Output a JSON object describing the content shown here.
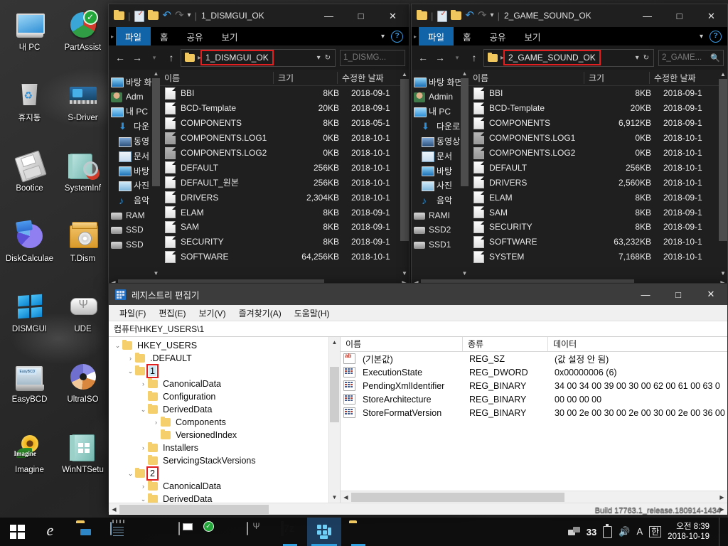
{
  "desktop": {
    "icons": [
      {
        "label": "내 PC",
        "icon": "my-computer-icon",
        "art": "ic-monitor"
      },
      {
        "label": "PartAssist",
        "icon": "partassist-icon",
        "art": "ic-pie"
      },
      {
        "label": "휴지통",
        "icon": "recycle-bin-icon",
        "art": "ic-bin"
      },
      {
        "label": "S-Driver",
        "icon": "s-driver-icon",
        "art": "ic-card"
      },
      {
        "label": "Bootice",
        "icon": "bootice-icon",
        "art": "ic-floppy"
      },
      {
        "label": "SystemInf",
        "icon": "systeminfo-icon",
        "art": "ic-book"
      },
      {
        "label": "DiskCalculae",
        "icon": "diskcalculator-icon",
        "art": "ic-pie2"
      },
      {
        "label": "T.Dism",
        "icon": "tdism-icon",
        "art": "ic-box"
      },
      {
        "label": "DISMGUI",
        "icon": "dismgui-icon",
        "art": "ic-win"
      },
      {
        "label": "UDE",
        "icon": "ude-usb-icon",
        "art": "ic-usb"
      },
      {
        "label": "EasyBCD",
        "icon": "easybcd-icon",
        "art": "ic-ebcd"
      },
      {
        "label": "UltraISO",
        "icon": "ultraiso-icon",
        "art": "ic-cd"
      },
      {
        "label": "Imagine",
        "icon": "imagine-icon",
        "art": "ic-flower",
        "badge": "Imagine"
      },
      {
        "label": "WinNTSetu",
        "icon": "winntsetup-icon",
        "art": "ic-ntbook"
      }
    ]
  },
  "explorer1": {
    "title": "1_DISMGUI_OK",
    "ribbon": {
      "file": "파일",
      "home": "홈",
      "share": "공유",
      "view": "보기",
      "help": "?"
    },
    "address": {
      "crumb": "1_DISMGUI_OK",
      "highlighted": true
    },
    "search": {
      "placeholder": "1_DISMG..."
    },
    "window_buttons": {
      "minimize": "—",
      "maximize": "□",
      "close": "✕"
    },
    "nav_pane": [
      {
        "label": "바탕 화",
        "icon": "desktop-icon"
      },
      {
        "label": "Adm",
        "icon": "user-icon"
      },
      {
        "label": "내 PC",
        "icon": "pc-icon"
      },
      {
        "label": "다운",
        "icon": "downloads-icon"
      },
      {
        "label": "동영",
        "icon": "videos-icon"
      },
      {
        "label": "문서",
        "icon": "documents-icon"
      },
      {
        "label": "바탕",
        "icon": "desktop-icon"
      },
      {
        "label": "사진",
        "icon": "pictures-icon"
      },
      {
        "label": "음악",
        "icon": "music-icon"
      },
      {
        "label": "RAM",
        "icon": "drive-icon"
      },
      {
        "label": "SSD",
        "icon": "drive-icon"
      },
      {
        "label": "SSD",
        "icon": "drive-icon"
      }
    ],
    "columns": {
      "name": "이름",
      "size": "크기",
      "date": "수정한 날짜"
    },
    "files": [
      {
        "name": "BBI",
        "size": "8KB",
        "date": "2018-09-1",
        "dim": false
      },
      {
        "name": "BCD-Template",
        "size": "20KB",
        "date": "2018-09-1",
        "dim": false
      },
      {
        "name": "COMPONENTS",
        "size": "8KB",
        "date": "2018-05-1",
        "dim": false
      },
      {
        "name": "COMPONENTS.LOG1",
        "size": "0KB",
        "date": "2018-10-1",
        "dim": true
      },
      {
        "name": "COMPONENTS.LOG2",
        "size": "0KB",
        "date": "2018-10-1",
        "dim": true
      },
      {
        "name": "DEFAULT",
        "size": "256KB",
        "date": "2018-10-1",
        "dim": false
      },
      {
        "name": "DEFAULT_원본",
        "size": "256KB",
        "date": "2018-10-1",
        "dim": false
      },
      {
        "name": "DRIVERS",
        "size": "2,304KB",
        "date": "2018-10-1",
        "dim": false
      },
      {
        "name": "ELAM",
        "size": "8KB",
        "date": "2018-09-1",
        "dim": false
      },
      {
        "name": "SAM",
        "size": "8KB",
        "date": "2018-09-1",
        "dim": false
      },
      {
        "name": "SECURITY",
        "size": "8KB",
        "date": "2018-09-1",
        "dim": false
      },
      {
        "name": "SOFTWARE",
        "size": "64,256KB",
        "date": "2018-10-1",
        "dim": false
      }
    ]
  },
  "explorer2": {
    "title": "2_GAME_SOUND_OK",
    "ribbon": {
      "file": "파일",
      "home": "홈",
      "share": "공유",
      "view": "보기",
      "help": "?"
    },
    "address": {
      "crumb": "2_GAME_SOUND_OK",
      "highlighted": true
    },
    "search": {
      "placeholder": "2_GAME..."
    },
    "window_buttons": {
      "minimize": "—",
      "maximize": "□",
      "close": "✕"
    },
    "nav_pane": [
      {
        "label": "바탕 화면",
        "icon": "desktop-icon"
      },
      {
        "label": "Admin",
        "icon": "user-icon"
      },
      {
        "label": "내 PC",
        "icon": "pc-icon"
      },
      {
        "label": "다운로",
        "icon": "downloads-icon"
      },
      {
        "label": "동영상",
        "icon": "videos-icon"
      },
      {
        "label": "문서",
        "icon": "documents-icon"
      },
      {
        "label": "바탕",
        "icon": "desktop-icon"
      },
      {
        "label": "사진",
        "icon": "pictures-icon"
      },
      {
        "label": "음악",
        "icon": "music-icon"
      },
      {
        "label": "RAMI",
        "icon": "drive-icon"
      },
      {
        "label": "SSD2",
        "icon": "drive-icon"
      },
      {
        "label": "SSD1",
        "icon": "drive-icon"
      }
    ],
    "columns": {
      "name": "이름",
      "size": "크기",
      "date": "수정한 날짜"
    },
    "files": [
      {
        "name": "BBI",
        "size": "8KB",
        "date": "2018-09-1",
        "dim": false
      },
      {
        "name": "BCD-Template",
        "size": "20KB",
        "date": "2018-09-1",
        "dim": false
      },
      {
        "name": "COMPONENTS",
        "size": "6,912KB",
        "date": "2018-09-1",
        "dim": false
      },
      {
        "name": "COMPONENTS.LOG1",
        "size": "0KB",
        "date": "2018-10-1",
        "dim": true
      },
      {
        "name": "COMPONENTS.LOG2",
        "size": "0KB",
        "date": "2018-10-1",
        "dim": true
      },
      {
        "name": "DEFAULT",
        "size": "256KB",
        "date": "2018-10-1",
        "dim": false
      },
      {
        "name": "DRIVERS",
        "size": "2,560KB",
        "date": "2018-10-1",
        "dim": false
      },
      {
        "name": "ELAM",
        "size": "8KB",
        "date": "2018-09-1",
        "dim": false
      },
      {
        "name": "SAM",
        "size": "8KB",
        "date": "2018-09-1",
        "dim": false
      },
      {
        "name": "SECURITY",
        "size": "8KB",
        "date": "2018-09-1",
        "dim": false
      },
      {
        "name": "SOFTWARE",
        "size": "63,232KB",
        "date": "2018-10-1",
        "dim": false
      },
      {
        "name": "SYSTEM",
        "size": "7,168KB",
        "date": "2018-10-1",
        "dim": false
      }
    ]
  },
  "regedit": {
    "title": "레지스트리 편집기",
    "window_buttons": {
      "minimize": "—",
      "maximize": "□",
      "close": "✕"
    },
    "menu": [
      "파일(F)",
      "편집(E)",
      "보기(V)",
      "즐겨찾기(A)",
      "도움말(H)"
    ],
    "path": "컴퓨터\\HKEY_USERS\\1",
    "tree": [
      {
        "label": "HKEY_USERS",
        "indent": 0,
        "expander": "⌄",
        "selected": false,
        "boxed": false
      },
      {
        "label": ".DEFAULT",
        "indent": 1,
        "expander": "›",
        "selected": false,
        "boxed": false
      },
      {
        "label": "1",
        "indent": 1,
        "expander": "⌄",
        "selected": true,
        "boxed": true
      },
      {
        "label": "CanonicalData",
        "indent": 2,
        "expander": "›",
        "selected": false,
        "boxed": false
      },
      {
        "label": "Configuration",
        "indent": 2,
        "expander": "",
        "selected": false,
        "boxed": false
      },
      {
        "label": "DerivedData",
        "indent": 2,
        "expander": "⌄",
        "selected": false,
        "boxed": false
      },
      {
        "label": "Components",
        "indent": 3,
        "expander": "›",
        "selected": false,
        "boxed": false
      },
      {
        "label": "VersionedIndex",
        "indent": 3,
        "expander": "",
        "selected": false,
        "boxed": false
      },
      {
        "label": "Installers",
        "indent": 2,
        "expander": "›",
        "selected": false,
        "boxed": false
      },
      {
        "label": "ServicingStackVersions",
        "indent": 2,
        "expander": "",
        "selected": false,
        "boxed": false
      },
      {
        "label": "2",
        "indent": 1,
        "expander": "⌄",
        "selected": false,
        "boxed": true
      },
      {
        "label": "CanonicalData",
        "indent": 2,
        "expander": "›",
        "selected": false,
        "boxed": false
      },
      {
        "label": "DerivedData",
        "indent": 2,
        "expander": "⌄",
        "selected": false,
        "boxed": false
      }
    ],
    "value_columns": {
      "name": "이름",
      "type": "종류",
      "data": "데이터"
    },
    "values": [
      {
        "name": "(기본값)",
        "type": "REG_SZ",
        "data": "(값 설정 안 됨)",
        "icon": "ab"
      },
      {
        "name": "ExecutionState",
        "type": "REG_DWORD",
        "data": "0x00000006 (6)",
        "icon": "bin"
      },
      {
        "name": "PendingXmlIdentifier",
        "type": "REG_BINARY",
        "data": "34 00 34 00 39 00 30 00 62 00 61 00 63 0",
        "icon": "bin"
      },
      {
        "name": "StoreArchitecture",
        "type": "REG_BINARY",
        "data": "00 00 00 00",
        "icon": "bin"
      },
      {
        "name": "StoreFormatVersion",
        "type": "REG_BINARY",
        "data": "30 00 2e 00 30 00 2e 00 30 00 2e 00 36 00",
        "icon": "bin"
      }
    ]
  },
  "watermark": "Build 17763.1_release.180914-1434",
  "taskbar": {
    "start": "start-button",
    "items": [
      {
        "name": "internet-explorer",
        "art": "gl-ie",
        "state": ""
      },
      {
        "name": "file-explorer",
        "art": "gl-fexp",
        "state": ""
      },
      {
        "name": "notepad",
        "art": "gl-note",
        "state": ""
      },
      {
        "name": "r-app",
        "art": "gl-r",
        "state": ""
      },
      {
        "name": "bootice",
        "art": "gl-floppy",
        "state": ""
      },
      {
        "name": "partassist",
        "art": "gl-pa",
        "state": ""
      },
      {
        "name": "ude-usb",
        "art": "gl-usb",
        "state": ""
      },
      {
        "name": "7zip",
        "art": "gl-7z",
        "state": "running"
      },
      {
        "name": "dismgui",
        "art": "gl-dism",
        "state": "active"
      },
      {
        "name": "folder",
        "art": "gl-fold2",
        "state": "running"
      }
    ],
    "tray": {
      "network": "network-icon",
      "count": "33",
      "usb": "usb-eject-icon",
      "volume": "🔊",
      "keyboard": "A",
      "ime": "한"
    },
    "clock": {
      "time": "오전 8:39",
      "date": "2018-10-19"
    }
  }
}
